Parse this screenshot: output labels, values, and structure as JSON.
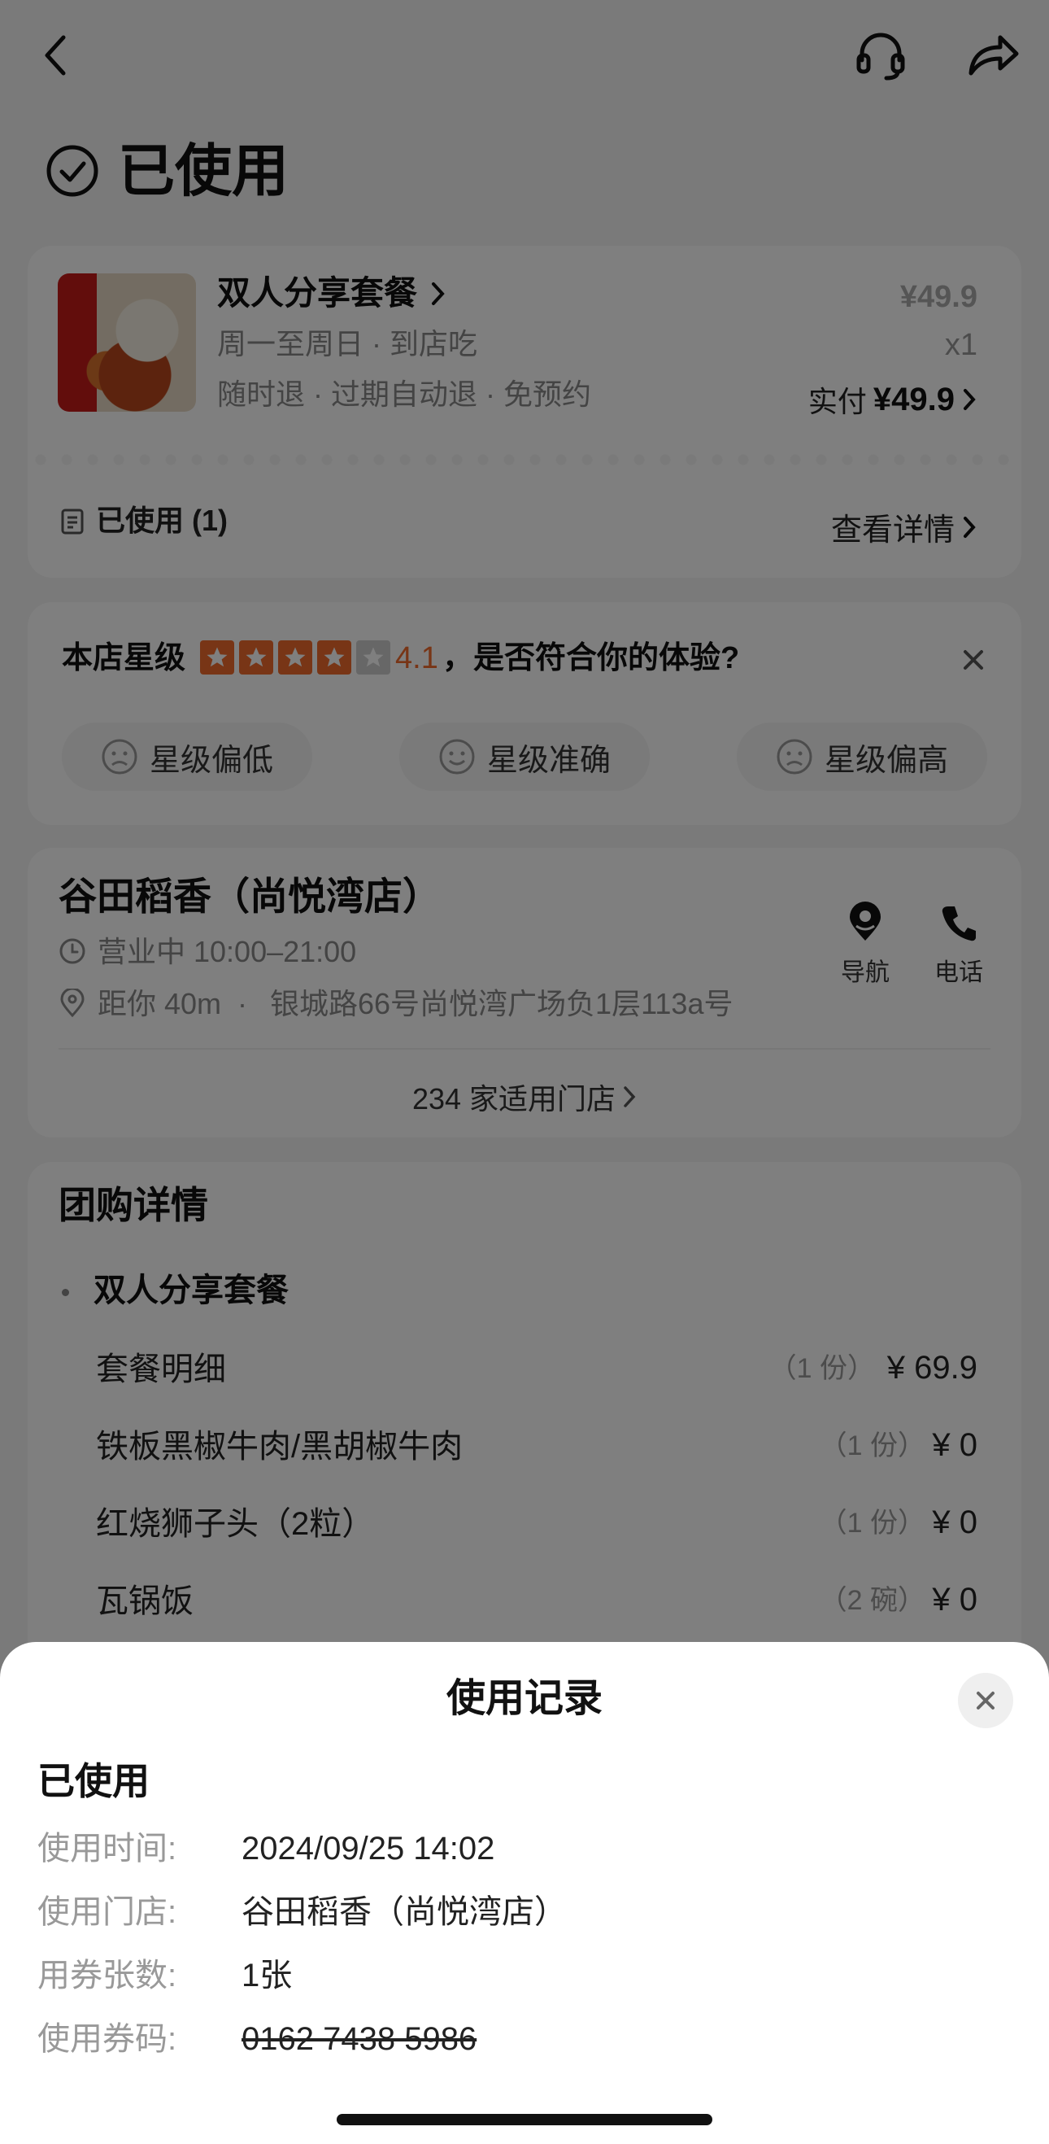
{
  "header": {
    "status_title": "已使用",
    "back_icon": "back-arrow-icon",
    "service_icon": "headset-icon",
    "share_icon": "share-icon"
  },
  "order": {
    "product_name": "双人分享套餐",
    "schedule": "周一至周日 · 到店吃",
    "policy": "随时退 · 过期自动退 · 免预约",
    "price": "¥49.9",
    "quantity": "x1",
    "paid_label": "实付",
    "paid_amount": "¥49.9",
    "used_label": "已使用 (1)",
    "view_details": "查看详情"
  },
  "rating": {
    "prefix": "本店星级",
    "score": "4.1",
    "stars_value": 4.1,
    "question": "，是否符合你的体验?",
    "options": [
      "星级偏低",
      "星级准确",
      "星级偏高"
    ]
  },
  "store": {
    "name": "谷田稻香（尚悦湾店）",
    "hours": "营业中 10:00–21:00",
    "distance": "距你 40m",
    "address": "银城路66号尚悦湾广场负1层113a号",
    "nav_label": "导航",
    "phone_label": "电话",
    "applicable": "234 家适用门店"
  },
  "group_buy": {
    "title": "团购详情",
    "package_name": "双人分享套餐",
    "items": [
      {
        "name": "套餐明细",
        "qty": "（1 份）",
        "price": "¥ 69.9"
      },
      {
        "name": "铁板黑椒牛肉/黑胡椒牛肉",
        "qty": "（1 份）",
        "price": "¥ 0"
      },
      {
        "name": "红烧狮子头（2粒）",
        "qty": "（1 份）",
        "price": "¥ 0"
      },
      {
        "name": "瓦锅饭",
        "qty": "（2 碗）",
        "price": "¥ 0"
      }
    ]
  },
  "sheet": {
    "title": "使用记录",
    "status": "已使用",
    "rows": [
      {
        "label": "使用时间:",
        "value": "2024/09/25 14:02"
      },
      {
        "label": "使用门店:",
        "value": "谷田稻香（尚悦湾店）"
      },
      {
        "label": "用券张数:",
        "value": "1张"
      },
      {
        "label": "使用券码:",
        "value": "0162 7438 5986"
      }
    ]
  },
  "colors": {
    "star_orange": "#f06b2c",
    "score_orange": "#f06b2c"
  }
}
